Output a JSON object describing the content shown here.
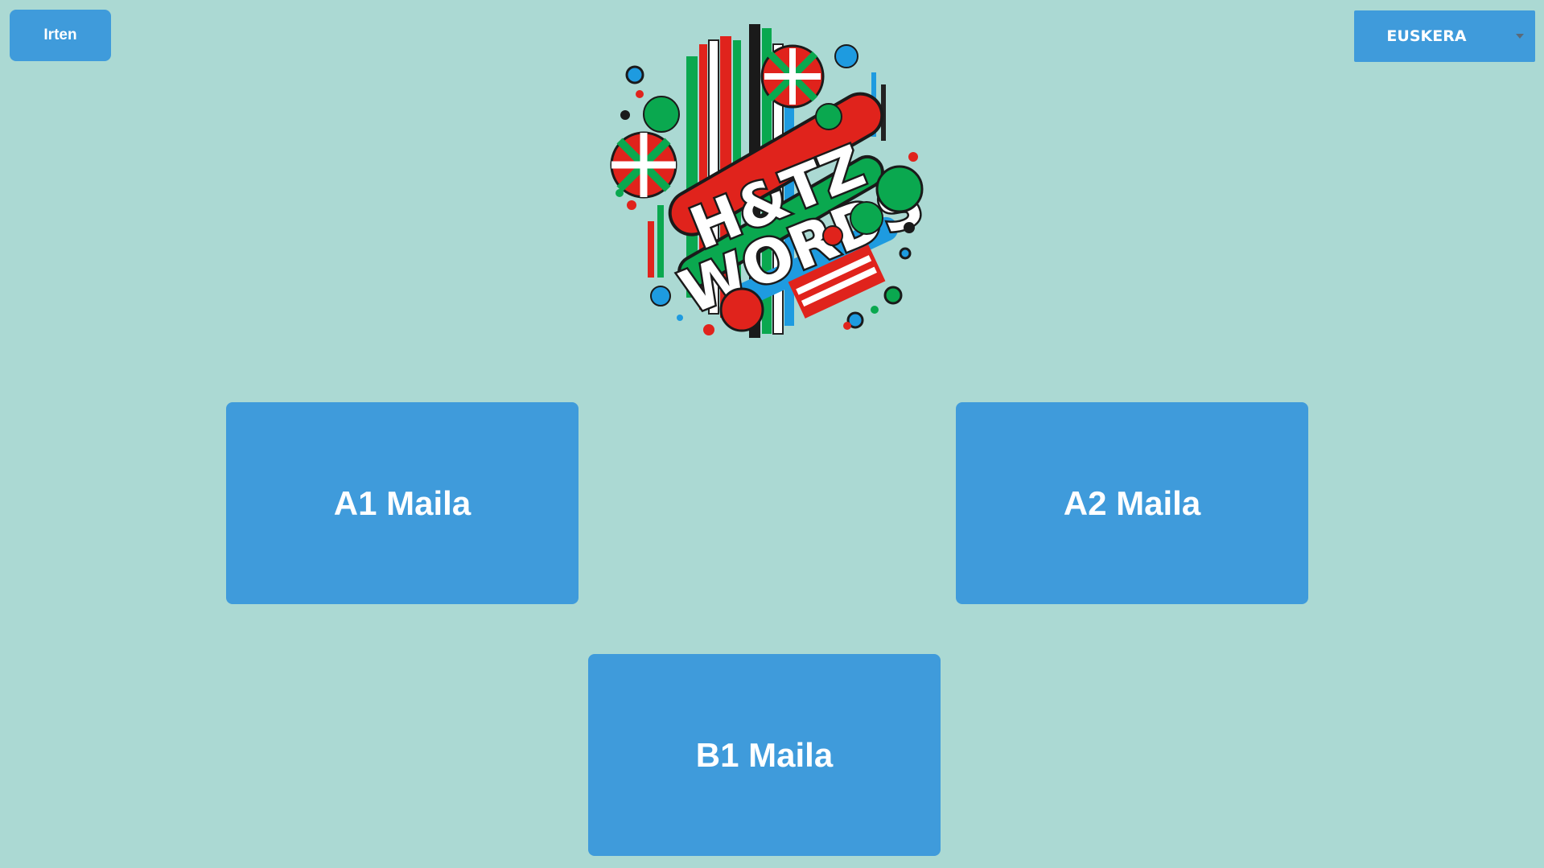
{
  "header": {
    "exit_label": "Irten",
    "language": {
      "selected": "EUSKERA"
    }
  },
  "logo": {
    "line1": "H&TZ",
    "line2": "WORDS"
  },
  "levels": [
    {
      "label": "A1 Maila"
    },
    {
      "label": "A2 Maila"
    },
    {
      "label": "B1 Maila"
    }
  ],
  "colors": {
    "background": "#abd9d3",
    "button": "#3f9bdb",
    "button_text": "#ffffff",
    "logo_red": "#e0231c",
    "logo_green": "#0aa84f",
    "logo_blue": "#1e9be0"
  }
}
